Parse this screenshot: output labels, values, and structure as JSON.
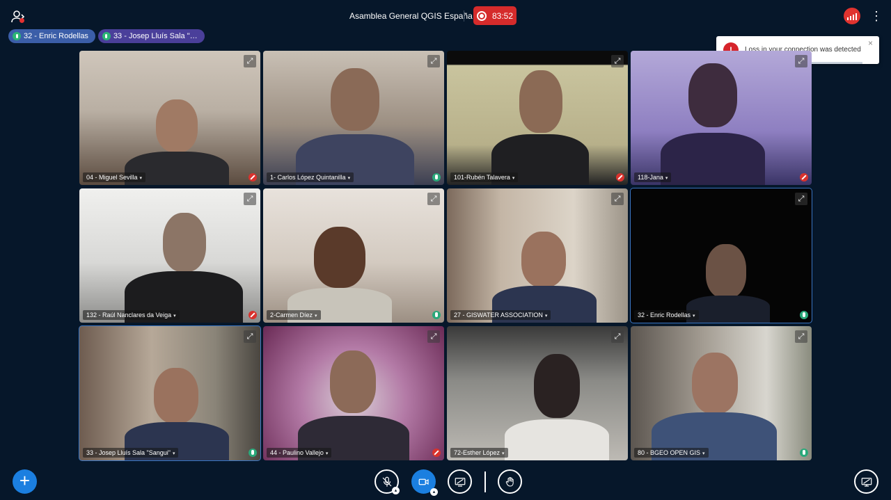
{
  "meeting": {
    "title": "Asamblea General QGIS España",
    "recording_time": "83:52"
  },
  "icons": {
    "users": "users-icon",
    "record": "record-icon",
    "connection": "signal-icon",
    "more": "kebab-icon",
    "actions": "plus-icon",
    "mic": "mic-muted-icon",
    "camera": "camera-icon",
    "screen": "screen-share-icon",
    "hand": "raise-hand-icon",
    "presentation": "presentation-icon"
  },
  "talkers": [
    {
      "label": "32 - Enric Rodellas"
    },
    {
      "label": "33 - Josep Lluís Sala \"…"
    }
  ],
  "toast": {
    "message": "Loss in your connection was detected",
    "close": "×"
  },
  "tiles": [
    {
      "name": "04 - Miguel Sevilla",
      "mic": "muted"
    },
    {
      "name": "1- Carlos López Quintanilla",
      "mic": "on"
    },
    {
      "name": "101-Rubén Talavera",
      "mic": "muted"
    },
    {
      "name": "118-Jana",
      "mic": "muted"
    },
    {
      "name": "132 - Raúl Nanclares da Veiga",
      "mic": "muted"
    },
    {
      "name": "2-Carmen Díez",
      "mic": "on"
    },
    {
      "name": "27 - GISWATER ASSOCIATION",
      "mic": "none"
    },
    {
      "name": "32 - Enric Rodellas",
      "mic": "on"
    },
    {
      "name": "33 - Josep Lluís Sala \"Sangui\"",
      "mic": "on"
    },
    {
      "name": "44 - Paulino Vallejo",
      "mic": "muted"
    },
    {
      "name": "72-Esther López",
      "mic": "none"
    },
    {
      "name": "80 - BGEO OPEN GIS",
      "mic": "on"
    }
  ],
  "colors": {
    "background": "#06172a",
    "accent": "#1b7fe0",
    "muted": "#d9322d",
    "talking": "#2aa87a",
    "record": "#d52b2b"
  }
}
